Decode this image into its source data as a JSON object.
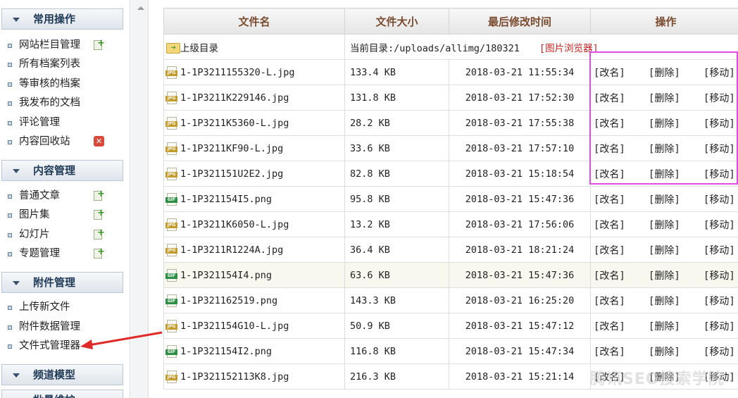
{
  "sidebar": {
    "sections": [
      {
        "title": "常用操作",
        "items": [
          {
            "label": "网站栏目管理",
            "badge": "add"
          },
          {
            "label": "所有档案列表",
            "badge": ""
          },
          {
            "label": "等审核的档案",
            "badge": ""
          },
          {
            "label": "我发布的文档",
            "badge": ""
          },
          {
            "label": "评论管理",
            "badge": ""
          },
          {
            "label": "内容回收站",
            "badge": "delete"
          }
        ]
      },
      {
        "title": "内容管理",
        "items": [
          {
            "label": "普通文章",
            "badge": "add"
          },
          {
            "label": "图片集",
            "badge": "add"
          },
          {
            "label": "幻灯片",
            "badge": "add"
          },
          {
            "label": "专题管理",
            "badge": "add"
          }
        ]
      },
      {
        "title": "附件管理",
        "items": [
          {
            "label": "上传新文件",
            "badge": ""
          },
          {
            "label": "附件数据管理",
            "badge": ""
          },
          {
            "label": "文件式管理器",
            "badge": ""
          }
        ]
      },
      {
        "title": "频道模型",
        "items": []
      },
      {
        "title": "批量维护",
        "items": []
      }
    ]
  },
  "table": {
    "headers": {
      "name": "文件名",
      "size": "文件大小",
      "mtime": "最后修改时间",
      "ops": "操作"
    },
    "parent_row": {
      "name": "上级目录",
      "current_dir": "当前目录:/uploads/allimg/180321",
      "browser_link": "[图片浏览器]"
    },
    "op_labels": {
      "rename": "[改名]",
      "delete": "[删除]",
      "move": "[移动]"
    },
    "files": [
      {
        "icon": "jpg",
        "name": "1-1P3211155320-L.jpg",
        "size": "133.4 KB",
        "mtime": "2018-03-21 11:55:34"
      },
      {
        "icon": "jpg",
        "name": "1-1P3211K229146.jpg",
        "size": "131.8 KB",
        "mtime": "2018-03-21 17:52:30"
      },
      {
        "icon": "jpg",
        "name": "1-1P3211K5360-L.jpg",
        "size": "28.2 KB",
        "mtime": "2018-03-21 17:55:38"
      },
      {
        "icon": "jpg",
        "name": "1-1P3211KF90-L.jpg",
        "size": "33.6 KB",
        "mtime": "2018-03-21 17:57:10"
      },
      {
        "icon": "jpg",
        "name": "1-1P321151U2E2.jpg",
        "size": "82.8 KB",
        "mtime": "2018-03-21 15:18:54"
      },
      {
        "icon": "gif",
        "name": "1-1P321154I5.png",
        "size": "95.8 KB",
        "mtime": "2018-03-21 15:47:36"
      },
      {
        "icon": "jpg",
        "name": "1-1P3211K6050-L.jpg",
        "size": "13.2 KB",
        "mtime": "2018-03-21 17:56:06"
      },
      {
        "icon": "jpg",
        "name": "1-1P3211R1224A.jpg",
        "size": "36.4 KB",
        "mtime": "2018-03-21 18:21:24"
      },
      {
        "icon": "gif",
        "name": "1-1P321154I4.png",
        "size": "63.6 KB",
        "mtime": "2018-03-21 15:47:36"
      },
      {
        "icon": "gif",
        "name": "1-1P321162519.png",
        "size": "143.3 KB",
        "mtime": "2018-03-21 16:25:20"
      },
      {
        "icon": "jpg",
        "name": "1-1P321154G10-L.jpg",
        "size": "50.9 KB",
        "mtime": "2018-03-21 15:47:12"
      },
      {
        "icon": "gif",
        "name": "1-1P321154I2.png",
        "size": "116.8 KB",
        "mtime": "2018-03-21 15:47:34"
      },
      {
        "icon": "jpg",
        "name": "1-1P321152113K8.jpg",
        "size": "216.3 KB",
        "mtime": "2018-03-21 15:21:14"
      }
    ]
  },
  "watermark": "腾讯SEO搜索学院",
  "colors": {
    "highlight_box": "#e34ce3",
    "arrow": "#e02a2a",
    "browser_link": "#d02020"
  }
}
